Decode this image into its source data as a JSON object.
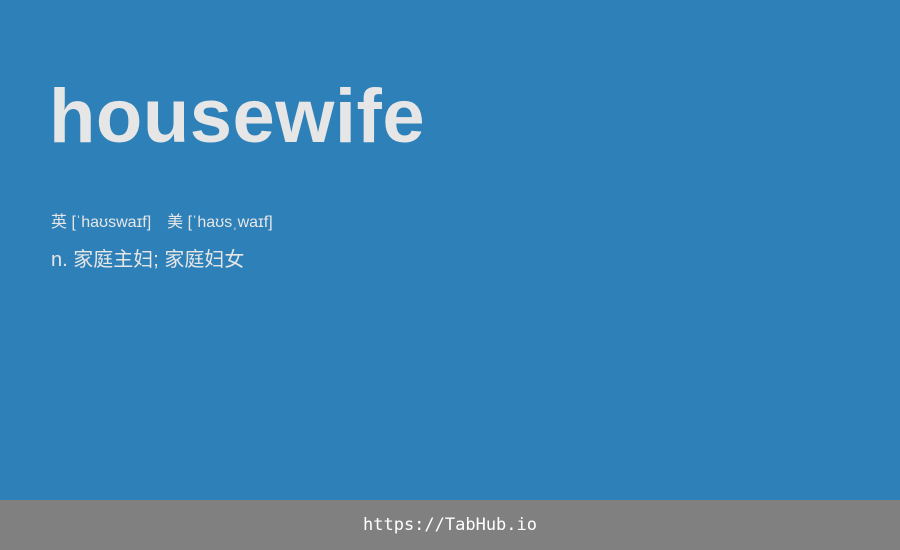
{
  "entry": {
    "word": "housewife",
    "phonetics": {
      "uk": "英 [ˈhaʊswaɪf]",
      "us": "美 [ˈhaʊsˌwaɪf]"
    },
    "definition": "n. 家庭主妇; 家庭妇女"
  },
  "footer": {
    "link": "https://TabHub.io"
  },
  "colors": {
    "background": "#2e81b8",
    "text": "#e6e6e6",
    "footer_background": "#808080",
    "footer_text": "#ffffff"
  }
}
